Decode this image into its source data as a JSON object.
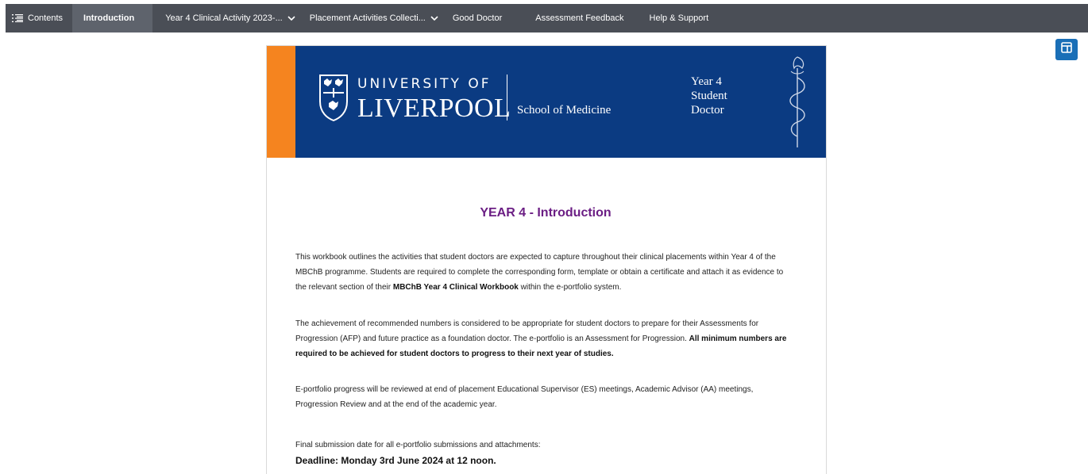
{
  "nav": {
    "contents": "Contents",
    "introduction": "Introduction",
    "year4": "Year 4 Clinical Activity 2023-...",
    "placement": "Placement Activities Collecti...",
    "good_doctor": "Good Doctor",
    "assessment": "Assessment Feedback",
    "help": "Help & Support"
  },
  "banner": {
    "uni_line1": "UNIVERSITY OF",
    "uni_line2": "LIVERPOOL",
    "school": "School of Medicine",
    "year_lines": [
      "Year 4",
      "Student",
      "Doctor"
    ]
  },
  "doc": {
    "heading": "YEAR 4 - Introduction",
    "p1_a": "This workbook outlines the activities that student doctors are expected to capture throughout their clinical placements within Year 4 of the MBChB programme. Students are required to complete the corresponding form, template or obtain a certificate and attach it as evidence to the relevant section of their ",
    "p1_b": "MBChB Year 4 Clinical Workbook",
    "p1_c": " within the e-portfolio system.",
    "p2_a": "The achievement of recommended numbers is considered to be appropriate for student doctors to prepare for their Assessments for Progression (AFP) and future practice as a foundation doctor. The e-portfolio is an Assessment for Progression. ",
    "p2_b": "All minimum numbers are required to be achieved for student doctors to progress to their next year of studies.",
    "p3": "E-portfolio progress will be reviewed at end of placement Educational Supervisor (ES) meetings, Academic Advisor (AA) meetings, Progression Review and at the end of the academic year.",
    "p4": "Final submission date for all e-portfolio submissions and attachments:",
    "deadline": "Deadline: Monday 3rd June 2024 at 12 noon."
  },
  "colors": {
    "topbar": "#4a4e56",
    "banner": "#0b3b82",
    "stripe": "#f5841f",
    "heading": "#6b1e84",
    "toggle": "#1a6fb7"
  },
  "icons": {
    "contents": "list-icon",
    "dropdown": "chevron-down-icon",
    "toggle": "panel-layout-icon",
    "crest": "crest-icon",
    "staff": "asclepius-staff-icon"
  }
}
